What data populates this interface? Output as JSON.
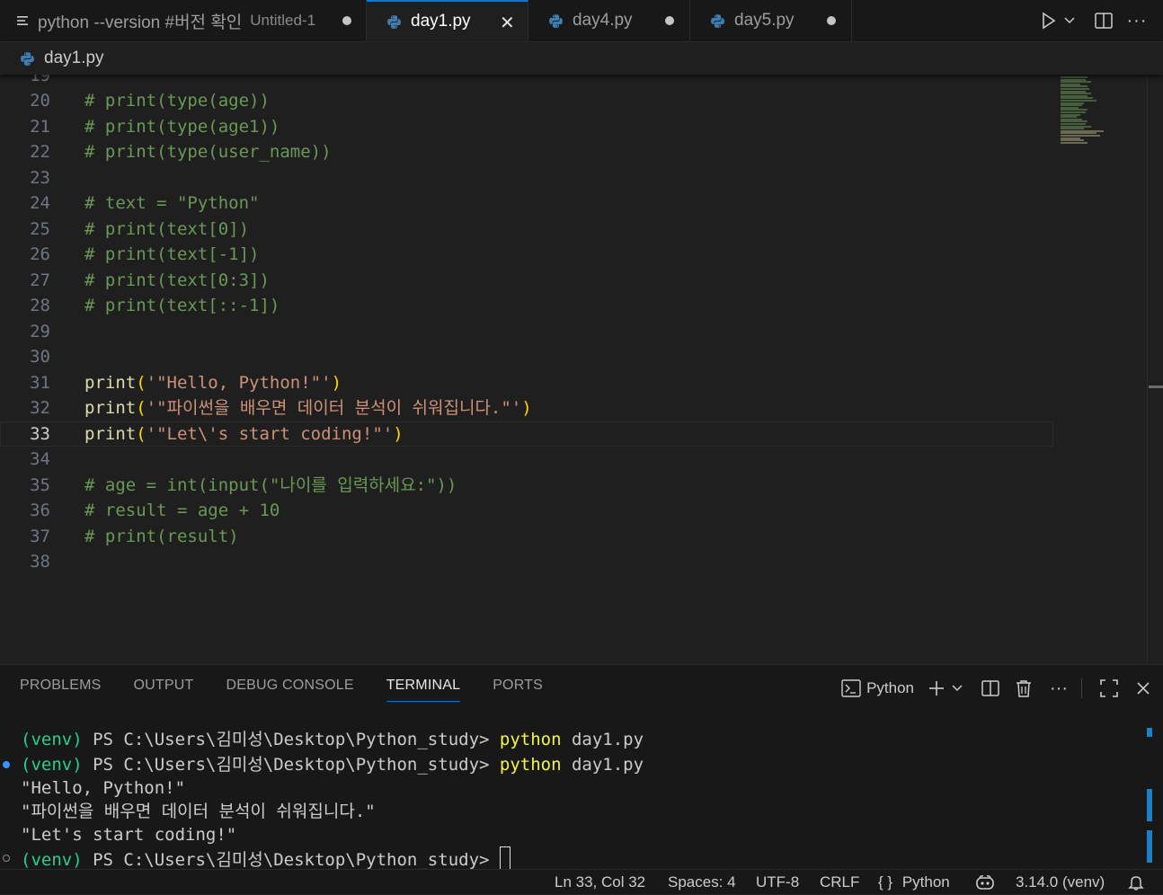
{
  "tabs": [
    {
      "label": "python --version #버전 확인",
      "description": "Untitled-1",
      "icon": "list-icon",
      "active": false,
      "modified": true
    },
    {
      "label": "day1.py",
      "icon": "python-icon",
      "active": true,
      "modified": false
    },
    {
      "label": "day4.py",
      "icon": "python-icon",
      "active": false,
      "modified": true
    },
    {
      "label": "day5.py",
      "icon": "python-icon",
      "active": false,
      "modified": true
    }
  ],
  "breadcrumb": {
    "file": "day1.py"
  },
  "editor": {
    "partial_line_number": "19",
    "current_line": "33",
    "lines": [
      {
        "n": "20",
        "tokens": [
          {
            "t": "# print(type(age))",
            "c": "cmt"
          }
        ]
      },
      {
        "n": "21",
        "tokens": [
          {
            "t": "# print(type(age1))",
            "c": "cmt"
          }
        ]
      },
      {
        "n": "22",
        "tokens": [
          {
            "t": "# print(type(user_name))",
            "c": "cmt"
          }
        ]
      },
      {
        "n": "23",
        "tokens": []
      },
      {
        "n": "24",
        "tokens": [
          {
            "t": "# text = \"Python\"",
            "c": "cmt"
          }
        ]
      },
      {
        "n": "25",
        "tokens": [
          {
            "t": "# print(text[0])",
            "c": "cmt"
          }
        ]
      },
      {
        "n": "26",
        "tokens": [
          {
            "t": "# print(text[-1])",
            "c": "cmt"
          }
        ]
      },
      {
        "n": "27",
        "tokens": [
          {
            "t": "# print(text[0:3])",
            "c": "cmt"
          }
        ]
      },
      {
        "n": "28",
        "tokens": [
          {
            "t": "# print(text[::-1])",
            "c": "cmt"
          }
        ]
      },
      {
        "n": "29",
        "tokens": []
      },
      {
        "n": "30",
        "tokens": []
      },
      {
        "n": "31",
        "tokens": [
          {
            "t": "print",
            "c": "fn"
          },
          {
            "t": "(",
            "c": "brk"
          },
          {
            "t": "'\"Hello, Python!\"'",
            "c": "str"
          },
          {
            "t": ")",
            "c": "brk"
          }
        ]
      },
      {
        "n": "32",
        "tokens": [
          {
            "t": "print",
            "c": "fn"
          },
          {
            "t": "(",
            "c": "brk"
          },
          {
            "t": "'\"파이썬을 배우면 데이터 분석이 쉬워집니다.\"'",
            "c": "str"
          },
          {
            "t": ")",
            "c": "brk"
          }
        ]
      },
      {
        "n": "33",
        "tokens": [
          {
            "t": "print",
            "c": "fn"
          },
          {
            "t": "(",
            "c": "brk"
          },
          {
            "t": "'\"Let\\'s start coding!\"'",
            "c": "str"
          },
          {
            "t": ")",
            "c": "brk"
          }
        ]
      },
      {
        "n": "34",
        "tokens": []
      },
      {
        "n": "35",
        "tokens": [
          {
            "t": "# age = int(input(\"나이를 입력하세요:\"))",
            "c": "cmt"
          }
        ]
      },
      {
        "n": "36",
        "tokens": [
          {
            "t": "# result = age + 10",
            "c": "cmt"
          }
        ]
      },
      {
        "n": "37",
        "tokens": [
          {
            "t": "# print(result)",
            "c": "cmt"
          }
        ]
      },
      {
        "n": "38",
        "tokens": []
      }
    ]
  },
  "panel": {
    "tabs": [
      {
        "label": "PROBLEMS",
        "active": false
      },
      {
        "label": "OUTPUT",
        "active": false
      },
      {
        "label": "DEBUG CONSOLE",
        "active": false
      },
      {
        "label": "TERMINAL",
        "active": true
      },
      {
        "label": "PORTS",
        "active": false
      }
    ],
    "terminal_profile": "Python",
    "terminal_lines": [
      {
        "deco": "none",
        "tokens": [
          {
            "t": "(venv)",
            "c": "venv"
          },
          {
            "t": " PS C:\\Users\\김미성\\Desktop\\Python_study> ",
            "c": ""
          },
          {
            "t": "python",
            "c": "cmd"
          },
          {
            "t": " day1.py",
            "c": ""
          }
        ]
      },
      {
        "deco": "success",
        "tokens": [
          {
            "t": "(venv)",
            "c": "venv"
          },
          {
            "t": " PS C:\\Users\\김미성\\Desktop\\Python_study> ",
            "c": ""
          },
          {
            "t": "python",
            "c": "cmd"
          },
          {
            "t": " day1.py",
            "c": ""
          }
        ]
      },
      {
        "deco": "none",
        "tokens": [
          {
            "t": "\"Hello, Python!\"",
            "c": ""
          }
        ]
      },
      {
        "deco": "none",
        "tokens": [
          {
            "t": "\"파이썬을 배우면 데이터 분석이 쉬워집니다.\"",
            "c": ""
          }
        ]
      },
      {
        "deco": "none",
        "tokens": [
          {
            "t": "\"Let's start coding!\"",
            "c": ""
          }
        ]
      },
      {
        "deco": "empty",
        "cursor": true,
        "tokens": [
          {
            "t": "(venv)",
            "c": "venv"
          },
          {
            "t": " PS C:\\Users\\김미성\\Desktop\\Python_study> ",
            "c": ""
          }
        ]
      }
    ]
  },
  "status": {
    "position": "Ln 33, Col 32",
    "spaces": "Spaces: 4",
    "encoding": "UTF-8",
    "eol": "CRLF",
    "language_braces": "{ }",
    "language": "Python",
    "interpreter": "3.14.0 (venv)"
  },
  "colors": {
    "accent": "#0078d4",
    "comment": "#6a9955",
    "function": "#dcdcaa",
    "bracket": "#ffd700",
    "string": "#ce9178",
    "venv": "#23d18b",
    "command": "#f5f543",
    "success_deco": "#3794ff"
  }
}
